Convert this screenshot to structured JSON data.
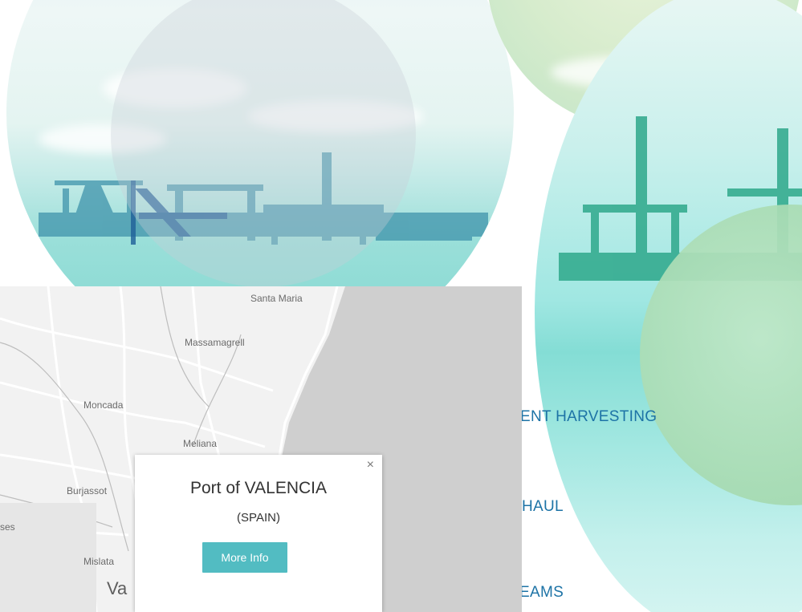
{
  "hero": {
    "nav_links": [
      {
        "label": "ENT HARVESTING"
      },
      {
        "label": "HAUL"
      },
      {
        "label": "EAMS"
      }
    ]
  },
  "map": {
    "places": [
      {
        "name": "Santa Maria"
      },
      {
        "name": "Massamagrell"
      },
      {
        "name": "Moncada"
      },
      {
        "name": "Meliana"
      },
      {
        "name": "Burjassot"
      },
      {
        "name": "ses"
      },
      {
        "name": "Mislata"
      },
      {
        "name": "Va"
      }
    ],
    "popup": {
      "title": "Port of VALENCIA",
      "subtitle": "(SPAIN)",
      "button_label": "More Info",
      "close_symbol": "×"
    }
  },
  "colors": {
    "link": "#1d73a6",
    "button": "#52bcc2",
    "sea_teal": "#84ddd5"
  }
}
